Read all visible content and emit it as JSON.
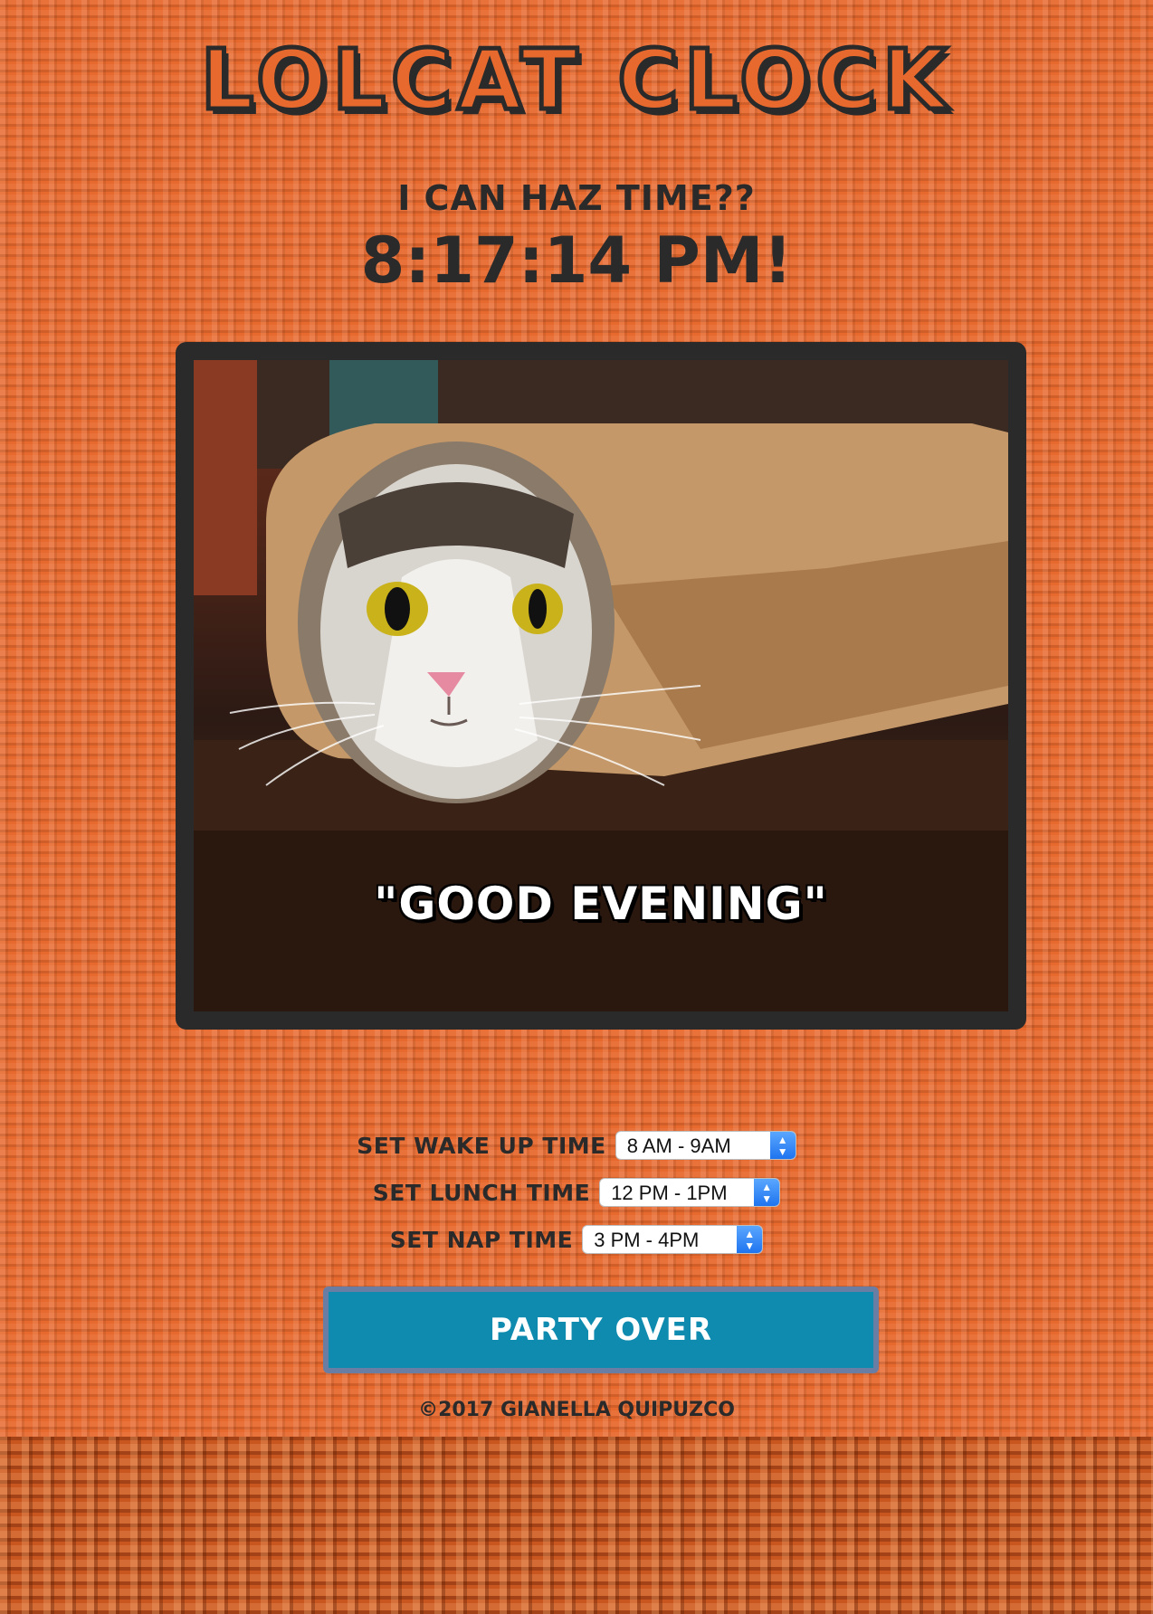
{
  "header": {
    "title": "LOLCAT CLOCK",
    "subtitle": "I CAN HAZ TIME??",
    "time": "8:17:14 PM!"
  },
  "image": {
    "caption": "\"GOOD EVENING\""
  },
  "settings": [
    {
      "label": "SET WAKE UP TIME",
      "value": "8 AM - 9AM"
    },
    {
      "label": "SET LUNCH TIME",
      "value": "12 PM - 1PM"
    },
    {
      "label": "SET NAP TIME",
      "value": "3 PM - 4PM"
    }
  ],
  "button": {
    "label": "PARTY OVER"
  },
  "footer": {
    "text": "©2017 GIANELLA QUIPUZCO"
  },
  "colors": {
    "background": "#e8692e",
    "text": "#2a2a2a",
    "button": "#0f8bb0",
    "frame": "#2a2a2a"
  },
  "icons": [
    "select-arrows-icon"
  ]
}
